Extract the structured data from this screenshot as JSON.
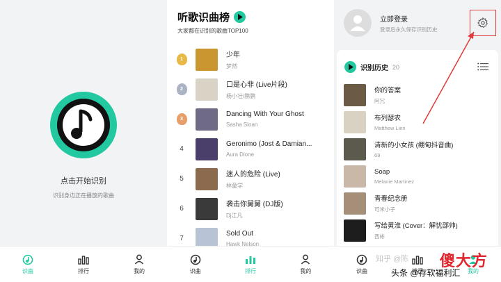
{
  "colors": {
    "accent": "#22c9a0",
    "highlight_box": "#e03a3a",
    "text_dark": "#222222",
    "text_muted": "#999999"
  },
  "recognize_panel": {
    "title": "点击开始识别",
    "subtitle": "识别身边正在播放的歌曲"
  },
  "tabs": [
    {
      "label": "识曲",
      "icon": "recognize-icon"
    },
    {
      "label": "排行",
      "icon": "chart-icon"
    },
    {
      "label": "我的",
      "icon": "user-icon"
    }
  ],
  "ranking_panel": {
    "title": "听歌识曲榜",
    "subtitle": "大家都在识别的歌曲TOP100",
    "items": [
      {
        "rank": "1",
        "title": "少年",
        "artist": "梦然",
        "cover_color": "#c9962f"
      },
      {
        "rank": "2",
        "title": "口是心非 (Live片段)",
        "artist": "杨小壮/鹏鹏",
        "cover_color": "#d8d3c4"
      },
      {
        "rank": "3",
        "title": "Dancing With Your Ghost",
        "artist": "Sasha Sloan",
        "cover_color": "#6f6a86"
      },
      {
        "rank": "4",
        "title": "Geronimo (Jost & Damian...",
        "artist": "Aura Dione",
        "cover_color": "#4a3f6b"
      },
      {
        "rank": "5",
        "title": "迷人的危险 (Live)",
        "artist": "林童学",
        "cover_color": "#8c6a4e"
      },
      {
        "rank": "6",
        "title": "袭击你舅舅 (DJ版)",
        "artist": "Dj江凡",
        "cover_color": "#3a3a3a"
      },
      {
        "rank": "7",
        "title": "Sold Out",
        "artist": "Hawk Nelson",
        "cover_color": "#b9c3d6"
      }
    ]
  },
  "profile_panel": {
    "login_label": "立即登录",
    "login_hint": "登录后永久保存识别历史",
    "history_title": "识别历史",
    "history_count": "20",
    "history": [
      {
        "title": "你的答案",
        "artist": "阿冗",
        "cover_color": "#6b5a44"
      },
      {
        "title": "布列瑟农",
        "artist": "Matthew Lien",
        "cover_color": "#d9d2c3"
      },
      {
        "title": "清新的小女孩 (绷甸抖音曲)",
        "artist": "69",
        "cover_color": "#5c5a4c"
      },
      {
        "title": "Soap",
        "artist": "Melanie Martinez",
        "cover_color": "#c9b8a8"
      },
      {
        "title": "青春纪念册",
        "artist": "可米小子",
        "cover_color": "#a58f78"
      },
      {
        "title": "写给黄淮 (Cover：解忧邵帅)",
        "artist": "西彬",
        "cover_color": "#1d1d1d"
      }
    ]
  },
  "watermark": {
    "faded": "知乎 @陈",
    "brand": "傻大方",
    "text": "头条 @存软福利汇"
  }
}
